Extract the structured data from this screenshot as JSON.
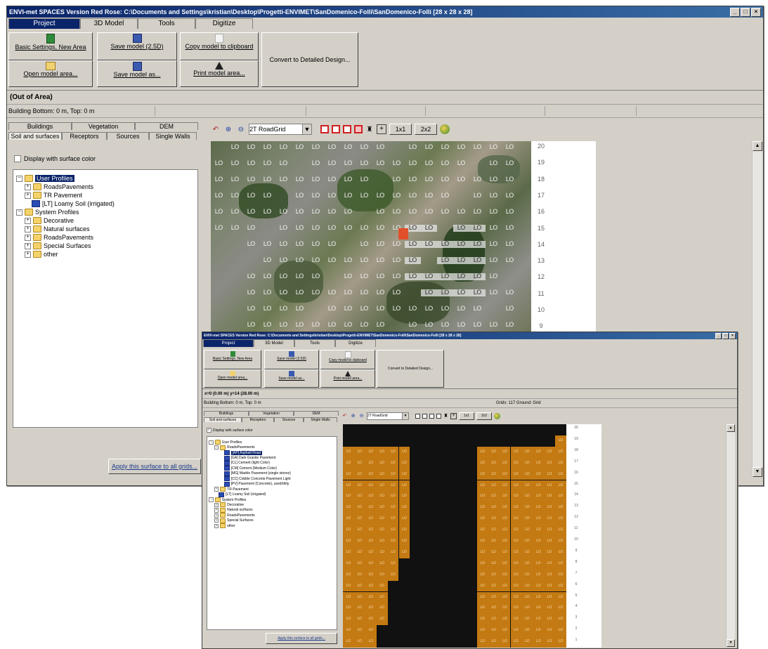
{
  "back": {
    "title": "ENVI-met SPACES Version Red Rose: C:\\Documents and Settings\\kristian\\Desktop\\Progetti-ENVIMET\\SanDomenico-Folli\\SanDomenico-Folli [28 x 28 x 28]",
    "window_controls": [
      "_",
      "□",
      "×"
    ],
    "main_tabs": [
      "Project",
      "3D Model",
      "Tools",
      "Digitize"
    ],
    "buttons": {
      "basic_settings": "Basic Settings, New Area",
      "open_model": "Open model area...",
      "save_model": "Save model (2.5D)",
      "save_model_as": "Save model as...",
      "copy_clipboard": "Copy model to clipboard",
      "print_model": "Print model area...",
      "convert": "Convert to Detailed Design..."
    },
    "area_label": "(Out of Area)",
    "status_text": "Building Bottom: 0 m, Top: 0 m",
    "sub_tabs_row1": [
      "Buildings",
      "Vegetation",
      "DEM"
    ],
    "sub_tabs_row2": [
      "Soil and surfaces",
      "Receptors",
      "Sources",
      "Single Walls"
    ],
    "display_surface_color": "Display with surface color",
    "tree": [
      {
        "label": "User Profiles",
        "expander": "−",
        "icon": "folder-icon",
        "selected": true
      },
      {
        "label": "RoadsPavements",
        "expander": "+",
        "icon": "folder-icon"
      },
      {
        "label": "TR Pavement",
        "expander": "+",
        "icon": "folder-icon"
      },
      {
        "label": "[LT] Loamy Soil (irrigated)",
        "expander": "",
        "icon": "material-icon"
      },
      {
        "label": "System Profiles",
        "expander": "−",
        "icon": "folder-icon"
      },
      {
        "label": "Decorative",
        "expander": "+",
        "icon": "folder-icon"
      },
      {
        "label": "Natural surfaces",
        "expander": "+",
        "icon": "folder-icon"
      },
      {
        "label": "RoadsPavements",
        "expander": "+",
        "icon": "folder-icon"
      },
      {
        "label": "Special Surfaces",
        "expander": "+",
        "icon": "folder-icon"
      },
      {
        "label": "other",
        "expander": "+",
        "icon": "folder-icon"
      }
    ],
    "apply_button": "Apply this surface to all grids...",
    "combo_value": "2T RoadGrid",
    "btn_1to1": "1x1",
    "btn_2x2": "2x2",
    "cell_label": "LO",
    "ruler": [
      "20",
      "19",
      "18",
      "17",
      "16",
      "15",
      "14",
      "13",
      "12",
      "11",
      "10",
      "9"
    ]
  },
  "front": {
    "title": "ENVI-met SPACES Version Red Rose: C:\\Documents and Settings\\kristian\\Desktop\\Progetti-ENVIMET\\SanDomenico-Folli\\SanDomenico-Folli [28 x 28 x 28]",
    "window_controls": [
      "_",
      "□",
      "×"
    ],
    "main_tabs": [
      "Project",
      "3D Model",
      "Tools",
      "Digitize"
    ],
    "buttons": {
      "basic_settings": "Basic Settings, New Area",
      "open_model": "Open model area...",
      "save_model": "Save model (2.5D)",
      "save_model_as": "Save model as...",
      "copy_clipboard": "Copy model to clipboard",
      "print_model": "Print model area...",
      "convert": "Convert to Detailed Design..."
    },
    "area_label": "x=0 (0.00 m) y=14 (28.00 m)",
    "status_text": "Building Bottom: 0 m, Top: 0 m",
    "status_right": "Grids: 117   Ground: Grid",
    "sub_tabs_row1": [
      "Buildings",
      "Vegetation",
      "DEM"
    ],
    "sub_tabs_row2": [
      "Soil and surfaces",
      "Receptors",
      "Sources",
      "Single Walls"
    ],
    "display_surface_color": "Display with surface color",
    "tree": [
      {
        "label": "User Profiles",
        "expander": "−",
        "icon": "folder-icon"
      },
      {
        "label": "RoadsPavements",
        "expander": "−",
        "icon": "folder-icon"
      },
      {
        "label": "[AP] Asphalt Road",
        "expander": "",
        "icon": "material-icon",
        "selected": true
      },
      {
        "label": "[GA] Dark Granite Pavement",
        "expander": "",
        "icon": "material-icon"
      },
      {
        "label": "[CL] Cement (light Color)",
        "expander": "",
        "icon": "material-icon"
      },
      {
        "label": "[CM] Cement (Medium Color)",
        "expander": "",
        "icon": "material-icon"
      },
      {
        "label": "[MG] Marble Pavement (single stones)",
        "expander": "",
        "icon": "material-icon"
      },
      {
        "label": "[CC] Cobble Concrete Pavement Light",
        "expander": "",
        "icon": "material-icon"
      },
      {
        "label": "[PV] Pavement (Concrete), used/dirty",
        "expander": "",
        "icon": "material-icon"
      },
      {
        "label": "TR Pavement",
        "expander": "+",
        "icon": "folder-icon"
      },
      {
        "label": "[LT] Loamy Soil (irrigated)",
        "expander": "",
        "icon": "material-icon"
      },
      {
        "label": "System Profiles",
        "expander": "−",
        "icon": "folder-icon"
      },
      {
        "label": "Decorative",
        "expander": "+",
        "icon": "folder-icon"
      },
      {
        "label": "Natural surfaces",
        "expander": "+",
        "icon": "folder-icon"
      },
      {
        "label": "RoadsPavements",
        "expander": "+",
        "icon": "folder-icon"
      },
      {
        "label": "Special Surfaces",
        "expander": "+",
        "icon": "folder-icon"
      },
      {
        "label": "other",
        "expander": "+",
        "icon": "folder-icon"
      }
    ],
    "apply_button": "Apply this surface to all grids...",
    "combo_value": "2T RoadGrid",
    "btn_1to1": "1x1",
    "btn_2x2": "2x2",
    "cell_label": "LO",
    "ruler": [
      "20",
      "19",
      "18",
      "17",
      "16",
      "15",
      "14",
      "13",
      "12",
      "11",
      "10",
      "9",
      "8",
      "7",
      "6",
      "5",
      "4",
      "3",
      "2",
      "1"
    ]
  },
  "colors": {
    "window_bg": "#d4d0c8",
    "title_bar": "#0a246a",
    "selection": "#0a246a",
    "grid_orange": "#c47a12",
    "grid_black": "#111111"
  }
}
